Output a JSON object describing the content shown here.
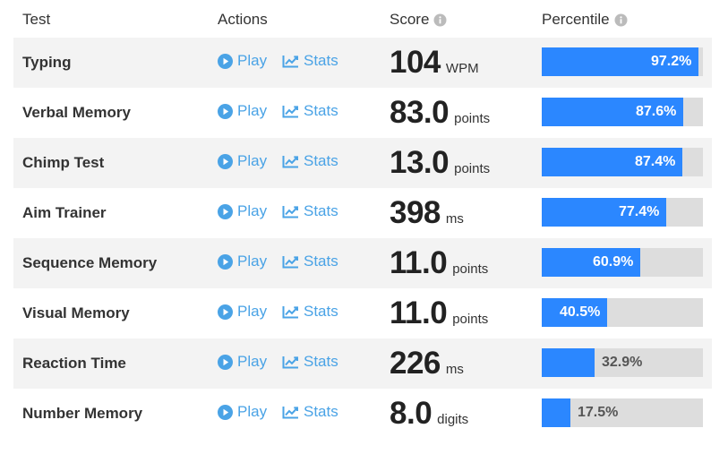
{
  "header": {
    "test": "Test",
    "actions": "Actions",
    "score": "Score",
    "percentile": "Percentile"
  },
  "colors": {
    "accent": "#2b87ff",
    "link": "#4aa3e6",
    "bar_track": "#dddddd",
    "row_alt": "#f3f3f3"
  },
  "rows": [
    {
      "test": "Typing",
      "play_label": "Play",
      "stats_label": "Stats",
      "score": "104",
      "unit": "WPM",
      "percentile_label": "97.2%",
      "percentile": 97.2
    },
    {
      "test": "Verbal Memory",
      "play_label": "Play",
      "stats_label": "Stats",
      "score": "83.0",
      "unit": "points",
      "percentile_label": "87.6%",
      "percentile": 87.6
    },
    {
      "test": "Chimp Test",
      "play_label": "Play",
      "stats_label": "Stats",
      "score": "13.0",
      "unit": "points",
      "percentile_label": "87.4%",
      "percentile": 87.4
    },
    {
      "test": "Aim Trainer",
      "play_label": "Play",
      "stats_label": "Stats",
      "score": "398",
      "unit": "ms",
      "percentile_label": "77.4%",
      "percentile": 77.4
    },
    {
      "test": "Sequence Memory",
      "play_label": "Play",
      "stats_label": "Stats",
      "score": "11.0",
      "unit": "points",
      "percentile_label": "60.9%",
      "percentile": 60.9
    },
    {
      "test": "Visual Memory",
      "play_label": "Play",
      "stats_label": "Stats",
      "score": "11.0",
      "unit": "points",
      "percentile_label": "40.5%",
      "percentile": 40.5
    },
    {
      "test": "Reaction Time",
      "play_label": "Play",
      "stats_label": "Stats",
      "score": "226",
      "unit": "ms",
      "percentile_label": "32.9%",
      "percentile": 32.9
    },
    {
      "test": "Number Memory",
      "play_label": "Play",
      "stats_label": "Stats",
      "score": "8.0",
      "unit": "digits",
      "percentile_label": "17.5%",
      "percentile": 17.5
    }
  ]
}
